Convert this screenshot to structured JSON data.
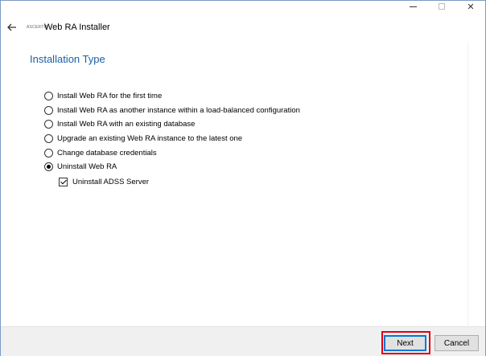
{
  "window": {
    "title": "Web RA  Installer",
    "logo_text": "ASCERTIA",
    "controls": {
      "minimize": "—",
      "restore": "",
      "close": "✕"
    }
  },
  "page": {
    "title": "Installation Type"
  },
  "options": [
    {
      "label": "Install Web RA  for the first time",
      "selected": false
    },
    {
      "label": "Install Web RA as another instance within a load-balanced configuration",
      "selected": false
    },
    {
      "label": "Install Web RA with an existing database",
      "selected": false
    },
    {
      "label": "Upgrade an existing Web RA instance to the latest one",
      "selected": false
    },
    {
      "label": "Change database credentials",
      "selected": false
    },
    {
      "label": "Uninstall Web RA",
      "selected": true
    }
  ],
  "sub_option": {
    "label": "Uninstall ADSS Server",
    "checked": true
  },
  "buttons": {
    "next": "Next",
    "cancel": "Cancel"
  },
  "colors": {
    "title": "#1a5fa8",
    "highlight": "#e00010",
    "focus": "#0078d7"
  },
  "icons": {
    "back": "back-arrow-icon",
    "close": "close-icon"
  }
}
